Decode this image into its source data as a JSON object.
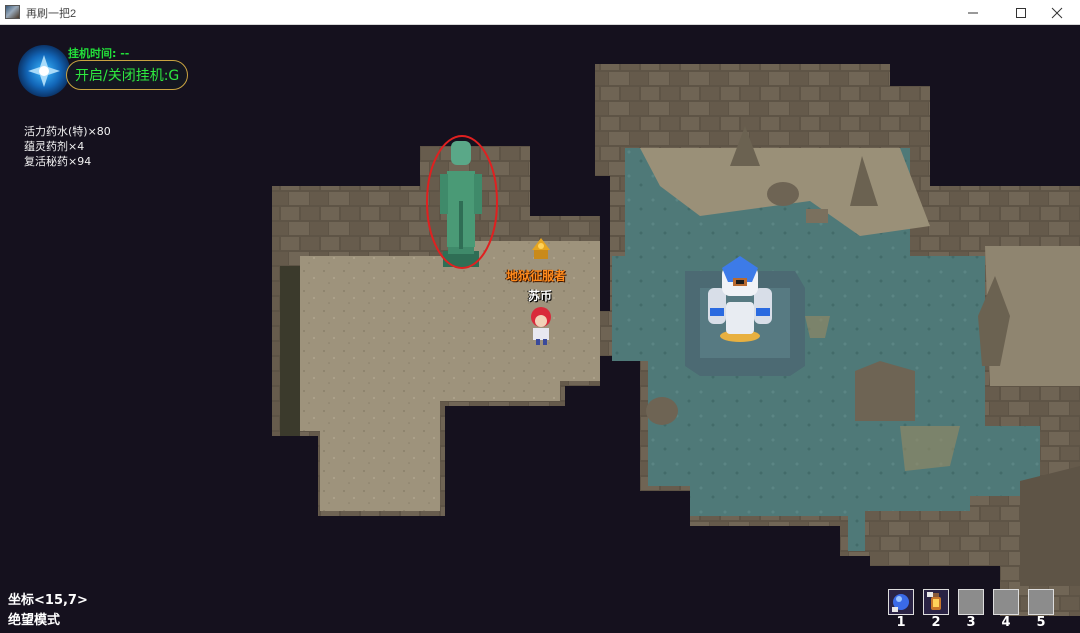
{
  "window": {
    "title": "再刷一把2",
    "controls": [
      "minimize-icon",
      "maximize-icon",
      "close-icon"
    ]
  },
  "hud": {
    "afk_time_label": "挂机时间: --",
    "afk_toggle_label": "开启/关闭挂机:G",
    "inventory": [
      "活力药水(特)×80",
      "蕴灵药剂×4",
      "复活秘药×94"
    ],
    "coords": "坐标<15,7>",
    "mode": "绝望模式"
  },
  "characters": {
    "player_title": "地狱征服者",
    "player_name": "苏币"
  },
  "hotbar": {
    "slots": [
      {
        "key": "1",
        "icon": "blue-orb-icon"
      },
      {
        "key": "2",
        "icon": "lantern-icon"
      },
      {
        "key": "3",
        "icon": "empty-slot"
      },
      {
        "key": "4",
        "icon": "empty-slot"
      },
      {
        "key": "5",
        "icon": "empty-slot"
      }
    ]
  },
  "colors": {
    "afk_text": "#2ee83f",
    "title_orange": "#ff8a1c",
    "highlight_circle": "#e02020",
    "background": "#15111e"
  }
}
